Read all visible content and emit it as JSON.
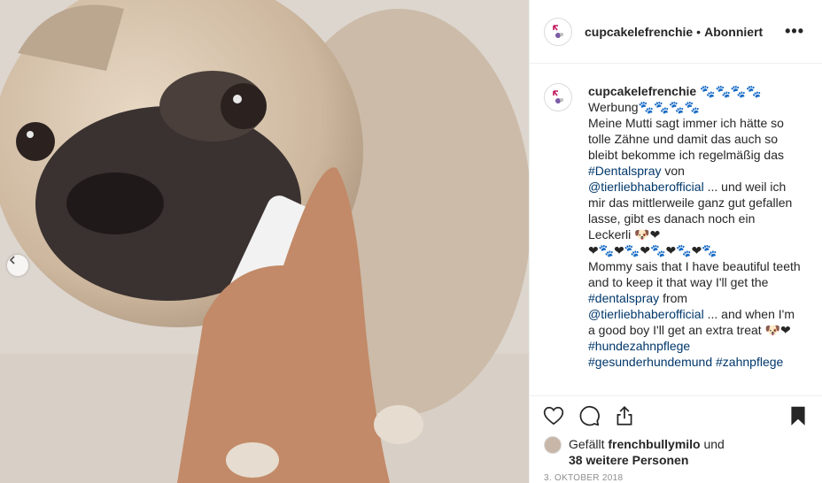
{
  "post": {
    "username": "cupcakelefrenchie",
    "separator": "•",
    "follow_status": "Abonniert",
    "more_label": "•••"
  },
  "caption": {
    "username": "cupcakelefrenchie",
    "lines": [
      "🐾🐾🐾🐾",
      "Werbung🐾🐾🐾🐾",
      "Meine Mutti sagt immer ich hätte so tolle Zähne und damit das auch so bleibt bekomme ich regelmäßig das",
      "#Dentalspray",
      "von",
      "@tierliebhaberofficial",
      "... und weil ich mir das mittlerweile ganz gut gefallen lasse, gibt es danach noch ein Leckerli 🐶❤",
      "❤🐾❤🐾❤🐾❤🐾❤🐾",
      "Mommy sais that I have beautiful teeth and to keep it that way I'll get the",
      "#dentalspray",
      "from",
      "@tierliebhaberofficial",
      "... and when I'm a good boy I'll get an extra treat 🐶❤",
      "#hundezahnpflege",
      "#gesunderhundemund",
      "#zahnpflege"
    ]
  },
  "likes": {
    "prefix": "Gefällt",
    "liked_by": "frenchbullymilo",
    "conj": "und",
    "others": "38 weitere Personen"
  },
  "date": "3. OKTOBER 2018",
  "icons": {
    "like": "heart-icon",
    "comment": "comment-icon",
    "share": "share-icon",
    "save": "bookmark-icon",
    "prev": "chevron-left-icon"
  },
  "colors": {
    "link": "#00376b",
    "text": "#262626",
    "muted": "#8e8e8e",
    "avatar_accent": "#c2185b"
  }
}
